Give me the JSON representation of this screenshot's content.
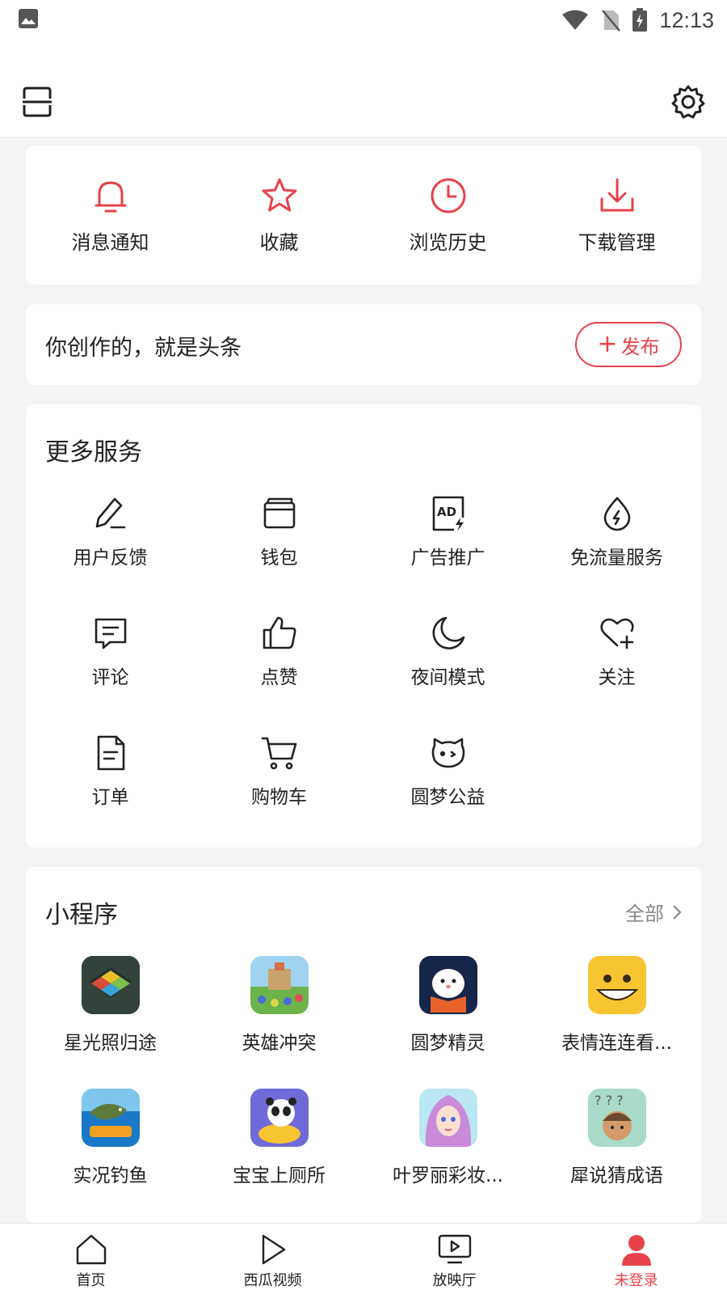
{
  "status_bar": {
    "time": "12:13"
  },
  "quick_actions": [
    {
      "label": "消息通知",
      "icon": "bell-icon"
    },
    {
      "label": "收藏",
      "icon": "star-icon"
    },
    {
      "label": "浏览历史",
      "icon": "clock-icon"
    },
    {
      "label": "下载管理",
      "icon": "download-icon"
    }
  ],
  "creator": {
    "text": "你创作的，就是头条",
    "button_plus": "+",
    "button_label": "发布"
  },
  "services": {
    "title": "更多服务",
    "items": [
      {
        "label": "用户反馈",
        "icon": "feedback-pen-icon"
      },
      {
        "label": "钱包",
        "icon": "wallet-icon"
      },
      {
        "label": "广告推广",
        "icon": "ad-icon"
      },
      {
        "label": "免流量服务",
        "icon": "data-drop-icon"
      },
      {
        "label": "评论",
        "icon": "comment-icon"
      },
      {
        "label": "点赞",
        "icon": "thumbs-up-icon"
      },
      {
        "label": "夜间模式",
        "icon": "moon-icon"
      },
      {
        "label": "关注",
        "icon": "heart-plus-icon"
      },
      {
        "label": "订单",
        "icon": "order-document-icon"
      },
      {
        "label": "购物车",
        "icon": "cart-icon"
      },
      {
        "label": "圆梦公益",
        "icon": "charity-cat-icon"
      }
    ]
  },
  "mini_programs": {
    "title": "小程序",
    "all_label": "全部",
    "items": [
      {
        "label": "星光照归途",
        "icon": "game-starlight-icon"
      },
      {
        "label": "英雄冲突",
        "icon": "game-hero-clash-icon"
      },
      {
        "label": "圆梦精灵",
        "icon": "game-dream-spirit-icon"
      },
      {
        "label": "表情连连看...",
        "icon": "game-emoji-match-icon"
      },
      {
        "label": "实况钓鱼",
        "icon": "game-fishing-icon"
      },
      {
        "label": "宝宝上厕所",
        "icon": "game-baby-potty-icon"
      },
      {
        "label": "叶罗丽彩妆...",
        "icon": "game-yeluoli-makeup-icon"
      },
      {
        "label": "犀说猜成语",
        "icon": "game-idiom-guess-icon"
      }
    ]
  },
  "bottom_nav": [
    {
      "label": "首页",
      "icon": "home-icon"
    },
    {
      "label": "西瓜视频",
      "icon": "play-icon"
    },
    {
      "label": "放映厅",
      "icon": "tv-icon"
    },
    {
      "label": "未登录",
      "icon": "user-icon",
      "active": true
    }
  ],
  "colors": {
    "accent": "#e8424a",
    "background": "#f4f4f4",
    "card": "#ffffff",
    "muted": "#888888"
  }
}
